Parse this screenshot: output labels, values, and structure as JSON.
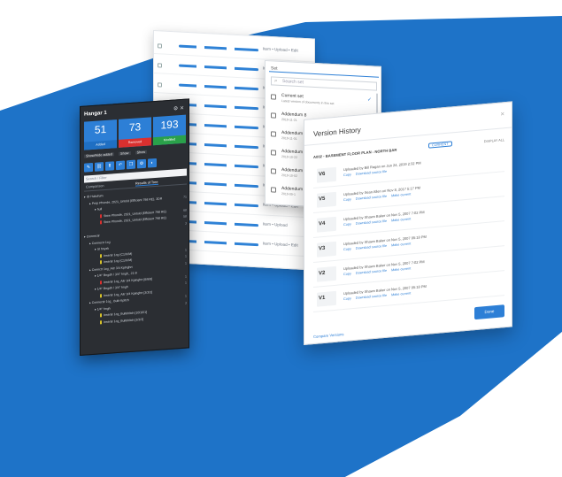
{
  "colors": {
    "accent": "#2d7fd6",
    "background_blue": "#1e73c8",
    "dark_panel": "#2b2e33"
  },
  "list_panel": {
    "rows": [
      "Item • Upload • Edit",
      "Item • U",
      "Item • U",
      "Item • U",
      "Item • U",
      "Item • U",
      "Item • U",
      "Item • U",
      "Item • Upload • Edit",
      "Item • Upload",
      "Item • Upload • Edit"
    ]
  },
  "dark_panel": {
    "title": "Hangar 1",
    "title_icons": "⚙ ✕",
    "stats": [
      {
        "value": "51",
        "label": "Added"
      },
      {
        "value": "73",
        "label": "Removed"
      },
      {
        "value": "193",
        "label": "Modified"
      }
    ],
    "filters": [
      "Show/Hide added",
      "Show",
      "Show"
    ],
    "toolbar_icons": [
      "pencil-icon",
      "link-icon",
      "arrow-up-icon",
      "undo-icon",
      "copy-icon",
      "settings-icon",
      "dark-mode-icon"
    ],
    "search_placeholder": "Search / Filter",
    "tabs": [
      "Comparison",
      "Results of Tree"
    ],
    "tree": [
      {
        "text": "▸ ID Hubdrum",
        "right": "",
        "indent": 0,
        "mark": ""
      },
      {
        "text": "▸ Prop Phonde, 2021_Untold (Efficient 798 RE), 3DR",
        "right": "71",
        "indent": 1,
        "mark": ""
      },
      {
        "text": "▸ hull",
        "right": "",
        "indent": 2,
        "mark": ""
      },
      {
        "text": "Stow Phonde, 2021_Untold (Efficient 798 RE)",
        "right": "68",
        "indent": 3,
        "mark": "#d9302f"
      },
      {
        "text": "Stow Phonde, 2021_Untold (Efficient 798 RE)",
        "right": "58",
        "indent": 3,
        "mark": "#d9302f"
      },
      {
        "text": "",
        "right": "3",
        "indent": 3,
        "mark": ""
      },
      {
        "text": "▸ Connectir",
        "right": "",
        "indent": 0,
        "mark": ""
      },
      {
        "text": "▸ Connectr 1cg",
        "right": "",
        "indent": 1,
        "mark": ""
      },
      {
        "text": "▸ Sl hnyzk",
        "right": "",
        "indent": 2,
        "mark": ""
      },
      {
        "text": "Insertir 1cg (C1/X/M)",
        "right": "1",
        "indent": 3,
        "mark": "#d6c12a"
      },
      {
        "text": "Insertir 1cg (C1/X/M)",
        "right": "1",
        "indent": 3,
        "mark": "#d6c12a"
      },
      {
        "text": "▸ Connctr 1cg_Aitr 3/4 Kplnghrt",
        "right": "1",
        "indent": 1,
        "mark": ""
      },
      {
        "text": "▸ 1/4\" Bngdh / 3/4\" hngh_ 21 B",
        "right": "",
        "indent": 2,
        "mark": ""
      },
      {
        "text": "Insertir 1cg_Aitr 3/4 Kplnghrt [6/6/8]",
        "right": "1",
        "indent": 3,
        "mark": "#d9302f"
      },
      {
        "text": "▸ 1/4\" Bngdh / 3/4\" hngh",
        "right": "1",
        "indent": 2,
        "mark": ""
      },
      {
        "text": "Insertir 1cg_Aitr 3/4 Kplnghrt [3/3/3]",
        "right": "",
        "indent": 3,
        "mark": "#d6c12a"
      },
      {
        "text": "▸ Connectir 1cg_ Bulit Kpltch",
        "right": "1",
        "indent": 1,
        "mark": ""
      },
      {
        "text": "▸ 1/4\" hngh",
        "right": "3",
        "indent": 2,
        "mark": ""
      },
      {
        "text": "Insertir 1cg_Bultkhltch [10/10/1]",
        "right": "",
        "indent": 3,
        "mark": "#d6c12a"
      },
      {
        "text": "Insertir 1cg_Bultkhltch [3/3/3]",
        "right": "",
        "indent": 3,
        "mark": "#d6c12a"
      }
    ]
  },
  "set_panel": {
    "header": "Set",
    "search_placeholder": "Search set",
    "items": [
      {
        "name": "Current set",
        "sub": "Latest version of documents in this set",
        "checked": true
      },
      {
        "name": "Addendum 8",
        "sub": "2019-11-21",
        "checked": false
      },
      {
        "name": "Addendum 7",
        "sub": "2019-11-01",
        "checked": false
      },
      {
        "name": "Addendum 6",
        "sub": "2019-10-22",
        "checked": false
      },
      {
        "name": "Addendum 5",
        "sub": "2019-10-02",
        "checked": false
      },
      {
        "name": "Addendum",
        "sub": "2019-09-1",
        "checked": false
      }
    ]
  },
  "version_history": {
    "title": "Version History",
    "close_icon": "×",
    "document": "A002 - BASEMENT FLOOR PLAN - NORTH BAR",
    "current_badge": "CURRENT",
    "range": "DISPLAY ALL",
    "versions": [
      {
        "label": "V6",
        "info": "Uploaded by Bill Ragan on Jun 24, 2019 2:32 PM",
        "links": [
          "Copy",
          "Download source file"
        ]
      },
      {
        "label": "V5",
        "info": "Uploaded by Sean Allen on Nov 8, 2017 5:17 PM",
        "links": [
          "Copy",
          "Download source file",
          "Make current"
        ]
      },
      {
        "label": "V4",
        "info": "Uploaded by Shawn Baker on Nov 5, 2007 7:02 PM",
        "links": [
          "Copy",
          "Download source file",
          "Make current"
        ]
      },
      {
        "label": "V3",
        "info": "Uploaded by Shawn Baker on Nov 5, 2007 05:18 PM",
        "links": [
          "Copy",
          "Download source file",
          "Make current"
        ]
      },
      {
        "label": "V2",
        "info": "Uploaded by Shawn Baker on Nov 5, 2007 7:02 PM",
        "links": [
          "Copy",
          "Download source file",
          "Make current"
        ]
      },
      {
        "label": "V1",
        "info": "Uploaded by Shawn Baker on Nov 5, 2007 05:18 PM",
        "links": [
          "Copy",
          "Download source file",
          "Make current"
        ]
      }
    ],
    "compare_link": "Compare Versions",
    "done_button": "Done"
  }
}
